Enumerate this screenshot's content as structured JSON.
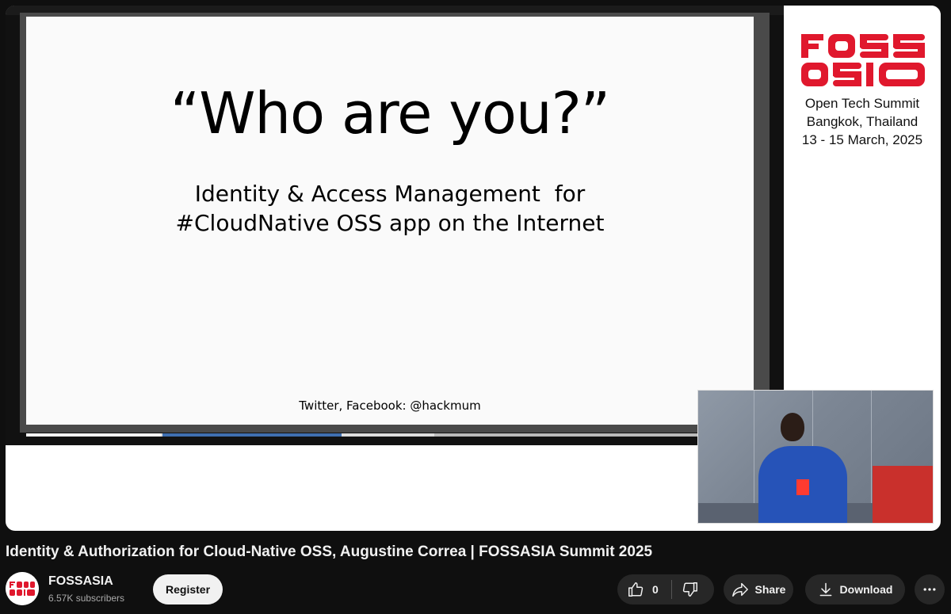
{
  "slide": {
    "title": "“Who are you?”",
    "subtitle_line1": "Identity & Access Management  for",
    "subtitle_line2": "#CloudNative OSS app on the Internet",
    "footer": "Twitter, Facebook: @hackmum"
  },
  "brand": {
    "logo_text": "FOSSASIA",
    "line1": "Open Tech Summit",
    "line2": "Bangkok, Thailand",
    "line3": "13 - 15 March, 2025",
    "accent_color": "#e0182d"
  },
  "video": {
    "title": "Identity & Authorization for Cloud-Native OSS, Augustine Correa | FOSSASIA Summit 2025"
  },
  "channel": {
    "name": "FOSSASIA",
    "subscribers": "6.57K subscribers",
    "register_label": "Register"
  },
  "actions": {
    "like_count": "0",
    "share_label": "Share",
    "download_label": "Download"
  },
  "icons": [
    "thumbs-up-icon",
    "thumbs-down-icon",
    "share-icon",
    "download-icon",
    "more-icon"
  ]
}
